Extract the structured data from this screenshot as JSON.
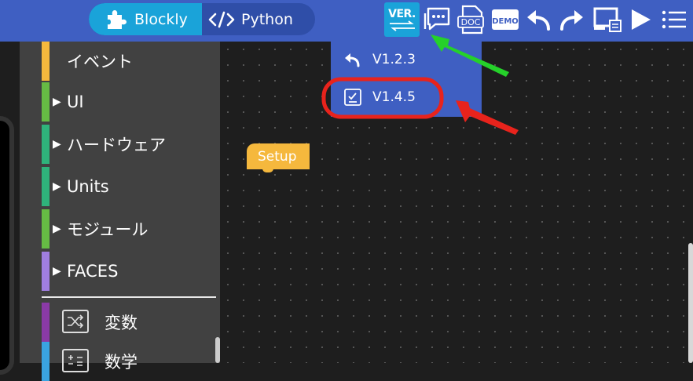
{
  "header": {
    "mode_blockly": "Blockly",
    "mode_python": "Python",
    "ver_label": "VER.",
    "doc_label": "DOC",
    "demo_label": "DEMO"
  },
  "version_menu": {
    "items": [
      {
        "label": "V1.2.3",
        "icon": "undo-arrow-icon"
      },
      {
        "label": "V1.4.5",
        "icon": "checklist-icon"
      }
    ]
  },
  "sidebar": {
    "categories": [
      {
        "label": "イベント",
        "color": "#f5b83d",
        "expandable": false
      },
      {
        "label": "UI",
        "color": "#66bb44",
        "expandable": true
      },
      {
        "label": "ハードウェア",
        "color": "#2fb37b",
        "expandable": true
      },
      {
        "label": "Units",
        "color": "#2fb37b",
        "expandable": true
      },
      {
        "label": "モジュール",
        "color": "#66bb44",
        "expandable": true
      },
      {
        "label": "FACES",
        "color": "#a07ee0",
        "expandable": true
      }
    ],
    "extra": [
      {
        "label": "変数",
        "color": "#8a3aa6",
        "icon": "shuffle-icon"
      },
      {
        "label": "数学",
        "color": "#3aa3e0",
        "icon": "math-icon"
      }
    ]
  },
  "workspace": {
    "setup_block": "Setup"
  },
  "colors": {
    "topbar": "#3f5fc2",
    "accent": "#1aa3d9",
    "highlight_red": "#e8231c",
    "highlight_green": "#25d12a"
  }
}
